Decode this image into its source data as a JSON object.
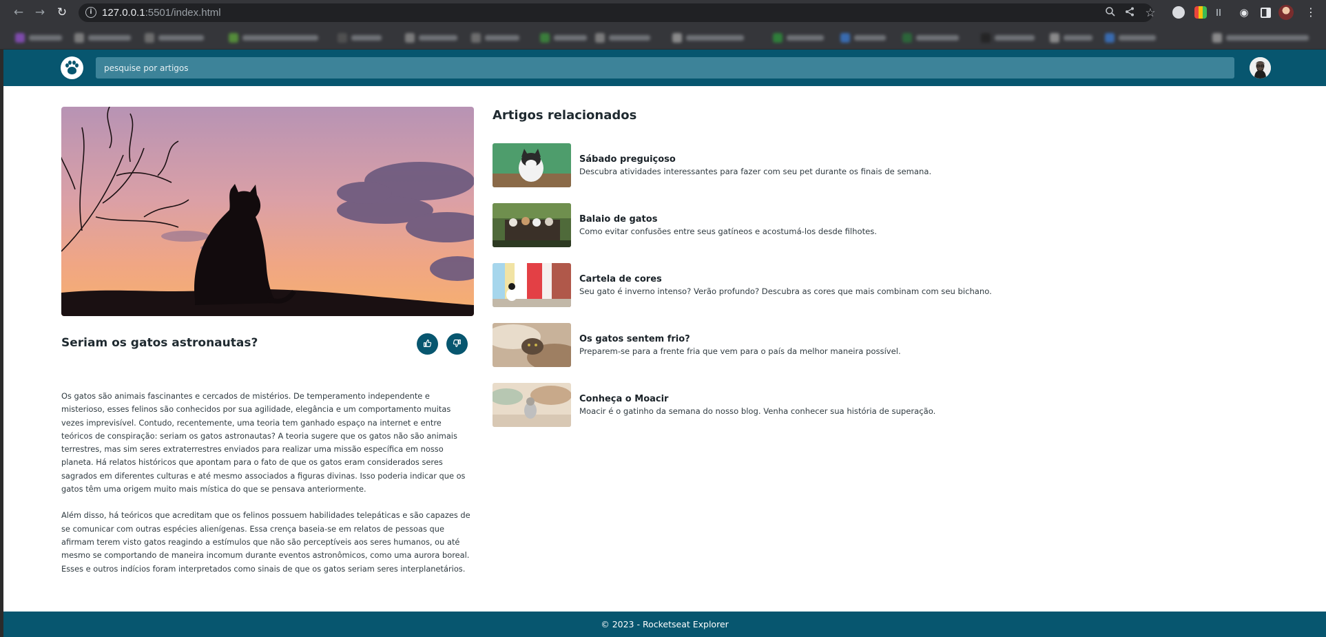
{
  "browser": {
    "url_host": "127.0.0.1",
    "url_rest": ":5501/index.html",
    "icons": {
      "back": "arrow-left-icon",
      "forward": "arrow-right-icon",
      "reload": "reload-icon",
      "zoom": "zoom-icon",
      "share": "share-icon",
      "bookmark": "star-icon",
      "extensions": "puzzle-icon",
      "sidepanel": "side-panel-icon",
      "menu": "kebab-menu-icon"
    }
  },
  "header": {
    "search_placeholder": "pesquise por artigos",
    "logo_icon": "paw-icon",
    "brand_color": "#07566f"
  },
  "article": {
    "title": "Seriam os gatos astronautas?",
    "like_icon": "thumbs-up-icon",
    "dislike_icon": "thumbs-down-icon",
    "paragraphs": [
      "Os gatos são animais fascinantes e cercados de mistérios. De temperamento independente e misterioso, esses felinos são conhecidos por sua agilidade, elegância e um comportamento muitas vezes imprevisível. Contudo, recentemente, uma teoria tem ganhado espaço na internet e entre teóricos de conspiração: seriam os gatos astronautas? A teoria sugere que os gatos não são animais terrestres, mas sim seres extraterrestres enviados para realizar uma missão específica em nosso planeta. Há relatos históricos que apontam para o fato de que os gatos eram considerados seres sagrados em diferentes culturas e até mesmo associados a figuras divinas. Isso poderia indicar que os gatos têm uma origem muito mais mística do que se pensava anteriormente.",
      "Além disso, há teóricos que acreditam que os felinos possuem habilidades telepáticas e são capazes de se comunicar com outras espécies alienígenas. Essa crença baseia-se em relatos de pessoas que afirmam terem visto gatos reagindo a estímulos que não são perceptíveis aos seres humanos, ou até mesmo se comportando de maneira incomum durante eventos astronômicos, como uma aurora boreal. Esses e outros indícios foram interpretados como sinais de que os gatos seriam seres interplanetários."
    ]
  },
  "related": {
    "heading": "Artigos relacionados",
    "items": [
      {
        "title": "Sábado preguiçoso",
        "description": "Descubra atividades interessantes para fazer com seu pet durante os finais de semana."
      },
      {
        "title": "Balaio de gatos",
        "description": "Como evitar confusões entre seus gatíneos e acostumá-los desde filhotes."
      },
      {
        "title": "Cartela de cores",
        "description": "Seu gato é inverno intenso? Verão profundo? Descubra as cores que mais combinam com seu bichano."
      },
      {
        "title": "Os gatos sentem frio?",
        "description": "Preparem-se para a frente fria que vem para o país da melhor maneira possível."
      },
      {
        "title": "Conheça o Moacir",
        "description": "Moacir é o gatinho da semana do nosso blog. Venha conhecer sua história de superação."
      }
    ]
  },
  "footer": {
    "text": "© 2023 - Rocketseat Explorer"
  }
}
